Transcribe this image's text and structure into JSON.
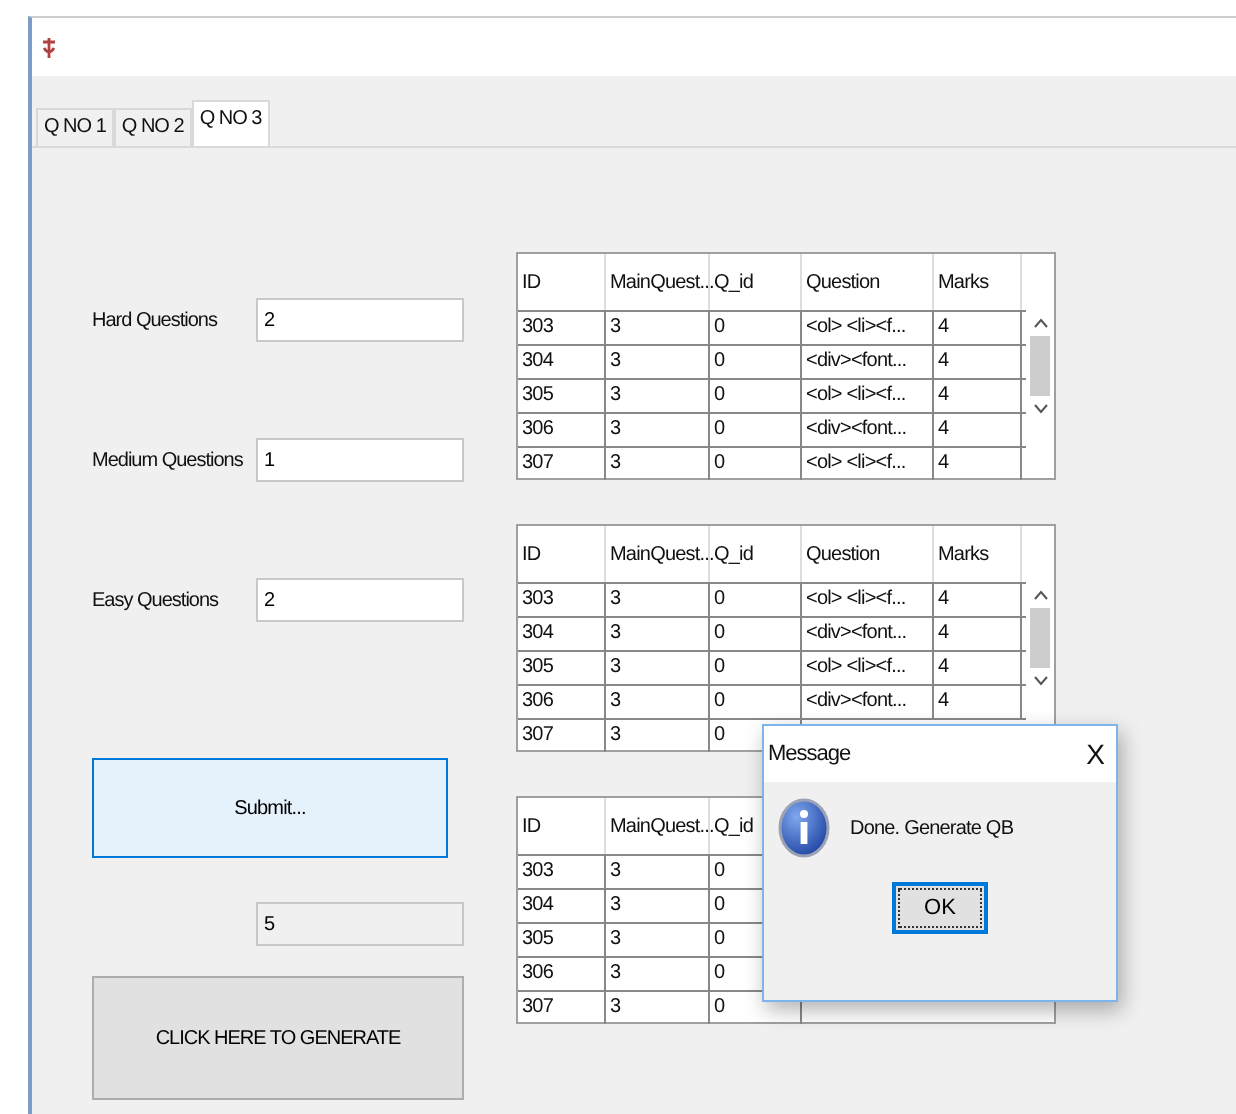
{
  "tabs": [
    {
      "label": "Q NO 1",
      "selected": false
    },
    {
      "label": "Q NO 2",
      "selected": false
    },
    {
      "label": "Q NO 3",
      "selected": true
    }
  ],
  "form": {
    "fields": [
      {
        "label": "Hard Questions",
        "value": "2"
      },
      {
        "label": "Medium Questions",
        "value": "1"
      },
      {
        "label": "Easy Questions",
        "value": "2"
      }
    ],
    "submit_button": "Submit...",
    "total_field": "5",
    "generate_button": "CLICK HERE TO GENERATE"
  },
  "tables": [
    {
      "columns": [
        "ID",
        "MainQuest...",
        "Q_id",
        "Question",
        "Marks"
      ],
      "rows": [
        [
          "303",
          "3",
          "0",
          "<ol> <li><f...",
          "4"
        ],
        [
          "304",
          "3",
          "0",
          "<div><font...",
          "4"
        ],
        [
          "305",
          "3",
          "0",
          "<ol> <li><f...",
          "4"
        ],
        [
          "306",
          "3",
          "0",
          "<div><font...",
          "4"
        ],
        [
          "307",
          "3",
          "0",
          "<ol> <li><f...",
          "4"
        ]
      ]
    },
    {
      "columns": [
        "ID",
        "MainQuest...",
        "Q_id",
        "Question",
        "Marks"
      ],
      "rows": [
        [
          "303",
          "3",
          "0",
          "<ol> <li><f...",
          "4"
        ],
        [
          "304",
          "3",
          "0",
          "<div><font...",
          "4"
        ],
        [
          "305",
          "3",
          "0",
          "<ol> <li><f...",
          "4"
        ],
        [
          "306",
          "3",
          "0",
          "<div><font...",
          "4"
        ],
        [
          "307",
          "3",
          "0"
        ]
      ]
    },
    {
      "columns": [
        "ID",
        "MainQuest...",
        "Q_id"
      ],
      "rows": [
        [
          "303",
          "3",
          "0"
        ],
        [
          "304",
          "3",
          "0"
        ],
        [
          "305",
          "3",
          "0"
        ],
        [
          "306",
          "3",
          "0"
        ],
        [
          "307",
          "3",
          "0"
        ]
      ]
    }
  ],
  "dialog": {
    "title": "Message",
    "close": "X",
    "message": "Done. Generate QB",
    "button": "OK"
  }
}
